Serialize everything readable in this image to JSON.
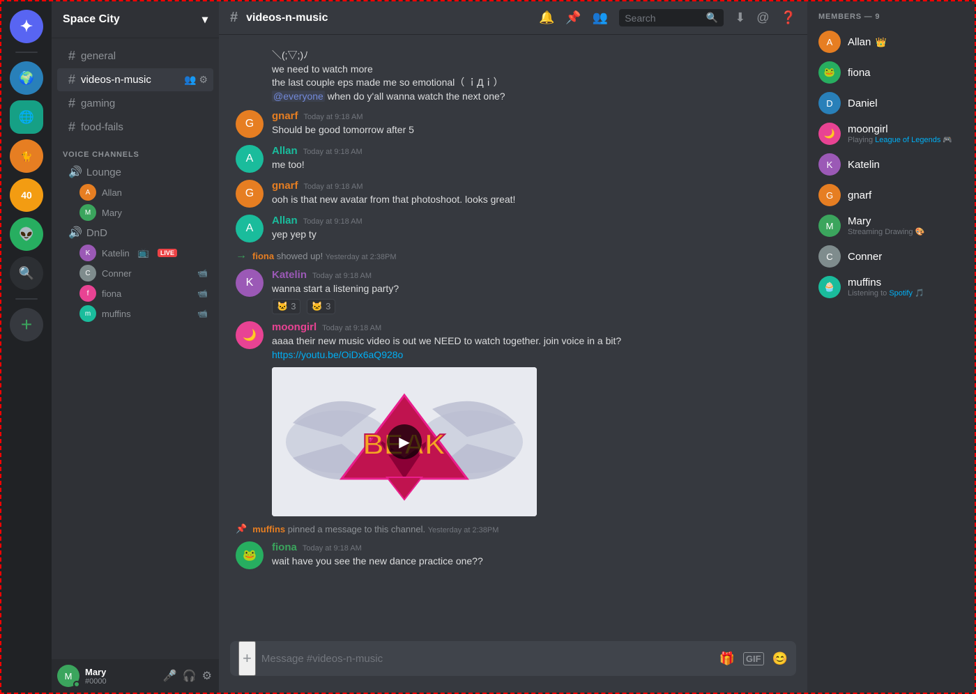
{
  "app": {
    "title": "DISCORD"
  },
  "server": {
    "name": "Space City",
    "dropdown_icon": "▾"
  },
  "channels": {
    "current": "videos-n-music",
    "text_channels": [
      {
        "id": "general",
        "name": "general"
      },
      {
        "id": "videos-n-music",
        "name": "videos-n-music",
        "active": true
      },
      {
        "id": "gaming",
        "name": "gaming"
      },
      {
        "id": "food-fails",
        "name": "food-fails"
      }
    ],
    "voice_section_label": "VOICE CHANNELS",
    "voice_channels": [
      {
        "id": "lounge",
        "name": "Lounge",
        "members": [
          {
            "name": "Allan",
            "color": "#e67e22"
          },
          {
            "name": "Mary",
            "color": "#3ba55d"
          }
        ]
      },
      {
        "id": "dnd",
        "name": "DnD",
        "members": [
          {
            "name": "Katelin",
            "color": "#9b59b6",
            "live": true
          },
          {
            "name": "Conner",
            "color": "#7f8c8d",
            "video": true
          },
          {
            "name": "fiona",
            "color": "#e84393",
            "video": true
          },
          {
            "name": "muffins",
            "color": "#1abc9c",
            "video": true
          }
        ]
      }
    ]
  },
  "header": {
    "channel_name": "videos-n-music",
    "search_placeholder": "Search",
    "icons": [
      "bell",
      "pin",
      "members",
      "search",
      "inbox",
      "mention",
      "help"
    ]
  },
  "messages": [
    {
      "id": "msg1",
      "type": "continuation",
      "text": "\\(;▽;)ﾉ",
      "sub_texts": [
        "we need to watch more",
        "the last couple eps made me so emotional（ ｉДｉ）",
        "@everyone when do y'all wanna watch the next one?"
      ],
      "author_color": "#e84393"
    },
    {
      "id": "msg2",
      "type": "message",
      "author": "gnarf",
      "timestamp": "Today at 9:18 AM",
      "text": "Should be good tomorrow after 5",
      "avatar_color": "#e67e22"
    },
    {
      "id": "msg3",
      "type": "message",
      "author": "Allan",
      "timestamp": "Today at 9:18 AM",
      "text": "me too!",
      "avatar_color": "#1abc9c"
    },
    {
      "id": "msg4",
      "type": "message",
      "author": "gnarf",
      "timestamp": "Today at 9:18 AM",
      "text": "ooh is that new avatar from that photoshoot. looks great!",
      "avatar_color": "#e67e22"
    },
    {
      "id": "msg5",
      "type": "message",
      "author": "Allan",
      "timestamp": "Today at 9:18 AM",
      "text": "yep yep ty",
      "avatar_color": "#1abc9c"
    },
    {
      "id": "msg6",
      "type": "system",
      "user": "fiona",
      "action": "showed up!",
      "timestamp": "Yesterday at 2:38PM"
    },
    {
      "id": "msg7",
      "type": "message",
      "author": "Katelin",
      "timestamp": "Today at 9:18 AM",
      "text": "wanna start a listening party?",
      "avatar_color": "#9b59b6",
      "reactions": [
        {
          "emoji": "🐱",
          "count": 3
        },
        {
          "emoji": "🐱",
          "count": 3
        }
      ]
    },
    {
      "id": "msg8",
      "type": "message",
      "author": "moongirl",
      "timestamp": "Today at 9:18 AM",
      "text": "aaaa their new music video is out we NEED to watch together. join voice in a bit?",
      "link": "https://youtu.be/OiDx6aQ928o",
      "avatar_color": "#e84393",
      "has_embed": true
    },
    {
      "id": "msg9",
      "type": "pinned",
      "user": "muffins",
      "action": "pinned a message to this channel.",
      "timestamp": "Yesterday at 2:38PM"
    },
    {
      "id": "msg10",
      "type": "message",
      "author": "fiona",
      "timestamp": "Today at 9:18 AM",
      "text": "wait have you see the new dance practice one??",
      "avatar_color": "#e84393"
    }
  ],
  "input": {
    "placeholder": "Message #videos-n-music"
  },
  "members": {
    "header": "MEMBERS — 9",
    "list": [
      {
        "name": "Allan",
        "color": "#e67e22",
        "crown": true,
        "online": true
      },
      {
        "name": "fiona",
        "color": "#27ae60",
        "online": true
      },
      {
        "name": "Daniel",
        "color": "#2980b9",
        "online": true
      },
      {
        "name": "moongirl",
        "color": "#e84393",
        "online": true,
        "status": "Playing League of Legends",
        "has_game_icon": true
      },
      {
        "name": "Katelin",
        "color": "#9b59b6",
        "online": true
      },
      {
        "name": "gnarf",
        "color": "#e67e22",
        "online": true
      },
      {
        "name": "Mary",
        "color": "#3ba55d",
        "online": true,
        "status": "Streaming Drawing 🎨",
        "streaming": true
      },
      {
        "name": "Conner",
        "color": "#7f8c8d",
        "online": true
      },
      {
        "name": "muffins",
        "color": "#1abc9c",
        "online": true,
        "status": "Listening to Spotify",
        "has_spotify": true
      }
    ]
  },
  "user": {
    "name": "Mary",
    "tag": "#0000",
    "color": "#3ba55d"
  },
  "server_icons": [
    {
      "id": "discord",
      "label": "Discord",
      "emoji": "✦",
      "color": "#5865f2"
    },
    {
      "id": "planet",
      "label": "Planet",
      "emoji": "🌍",
      "color": "#2980b9"
    },
    {
      "id": "space",
      "label": "Space City",
      "emoji": "🌐",
      "color": "#16a085"
    },
    {
      "id": "cat",
      "label": "Cat",
      "emoji": "🐱",
      "color": "#e67e22"
    },
    {
      "id": "number",
      "label": "40",
      "emoji": "40",
      "color": "#f39c12"
    },
    {
      "id": "alien",
      "label": "Alien",
      "emoji": "👽",
      "color": "#27ae60"
    },
    {
      "id": "search",
      "label": "Search",
      "emoji": "🔍",
      "color": "#2c2f33"
    },
    {
      "id": "add",
      "label": "Add",
      "emoji": "+",
      "color": "#36393f"
    }
  ]
}
